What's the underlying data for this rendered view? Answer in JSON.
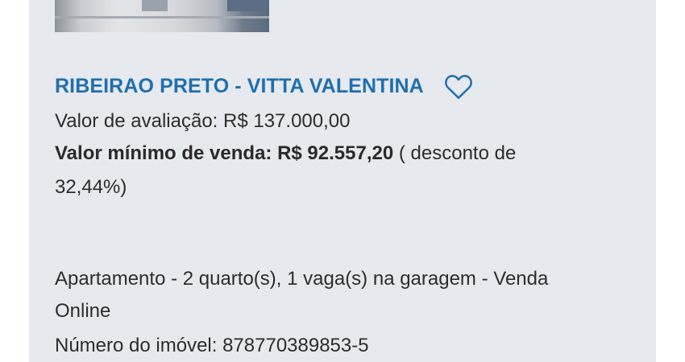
{
  "listing": {
    "title": "RIBEIRAO PRETO - VITTA VALENTINA",
    "favorite_icon": "heart-outline-icon",
    "valuation_text": "Valor de avaliação: R$ 137.000,00",
    "min_sale_label": "Valor mínimo de venda:",
    "min_sale_value": "R$ 92.557,20",
    "discount_prefix": "( desconto de",
    "discount_value": "32,44%)",
    "description_line1": "Apartamento - 2 quarto(s), 1 vaga(s) na garagem - Venda",
    "description_line2": "Online",
    "property_number": "Número do imóvel: 878770389853-5"
  },
  "colors": {
    "title": "#1f6fae",
    "card_background": "#e6e9ee",
    "text": "#2d2d2d"
  }
}
